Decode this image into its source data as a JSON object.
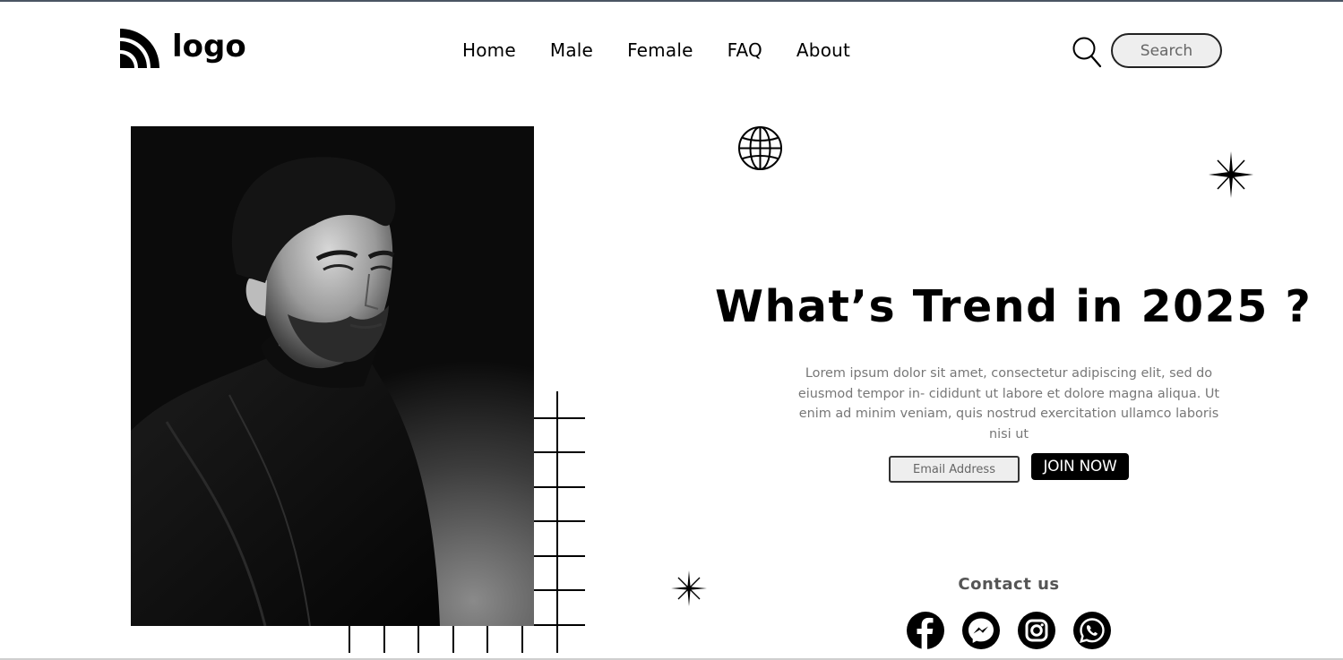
{
  "header": {
    "logo_text": "logo",
    "nav": [
      "Home",
      "Male",
      "Female",
      "FAQ",
      "About"
    ],
    "search_placeholder": "Search"
  },
  "hero": {
    "headline": "What’s Trend in 2025 ?",
    "description": "Lorem ipsum dolor sit amet, consectetur adipiscing elit, sed do eiusmod tempor in- cididunt ut labore et dolore magna aliqua. Ut enim ad minim veniam, quis nostrud exercitation ullamco laboris nisi ut",
    "email_placeholder": "Email Address",
    "join_label": "JOIN NOW"
  },
  "contact": {
    "title": "Contact us",
    "icons": [
      "facebook-icon",
      "messenger-icon",
      "instagram-icon",
      "whatsapp-icon"
    ]
  },
  "colors": {
    "primary": "#000000",
    "background": "#ffffff",
    "muted_text": "#777777",
    "input_bg": "#eeeeee"
  }
}
